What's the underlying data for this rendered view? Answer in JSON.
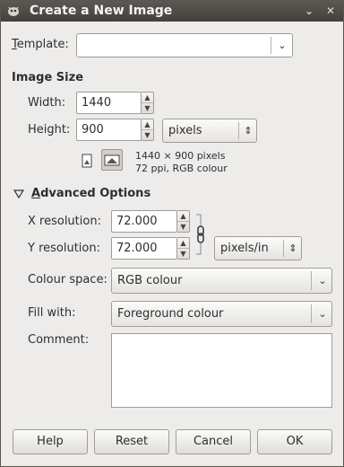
{
  "window": {
    "title": "Create a New Image"
  },
  "template": {
    "label": "Template:",
    "value": ""
  },
  "image_size": {
    "heading": "Image Size",
    "width_label": "Width:",
    "width_value": "1440",
    "height_label": "Height:",
    "height_value": "900",
    "unit": "pixels",
    "info_line1": "1440 × 900 pixels",
    "info_line2": "72 ppi, RGB colour"
  },
  "advanced": {
    "heading": "Advanced Options",
    "expanded": true,
    "x_res_label": "X resolution:",
    "x_res_value": "72.000",
    "y_res_label": "Y resolution:",
    "y_res_value": "72.000",
    "res_unit": "pixels/in",
    "colour_space_label": "Colour space:",
    "colour_space_value": "RGB colour",
    "fill_label": "Fill with:",
    "fill_value": "Foreground colour",
    "comment_label": "Comment:",
    "comment_value": ""
  },
  "buttons": {
    "help": "Help",
    "reset": "Reset",
    "cancel": "Cancel",
    "ok": "OK"
  },
  "icons": {
    "app": "gimp-wilber-icon",
    "window_menu": "chevron-down-icon",
    "close": "close-icon",
    "portrait": "portrait-orientation-icon",
    "landscape": "landscape-orientation-icon",
    "chain": "chain-link-icon",
    "expander": "triangle-down-icon"
  }
}
